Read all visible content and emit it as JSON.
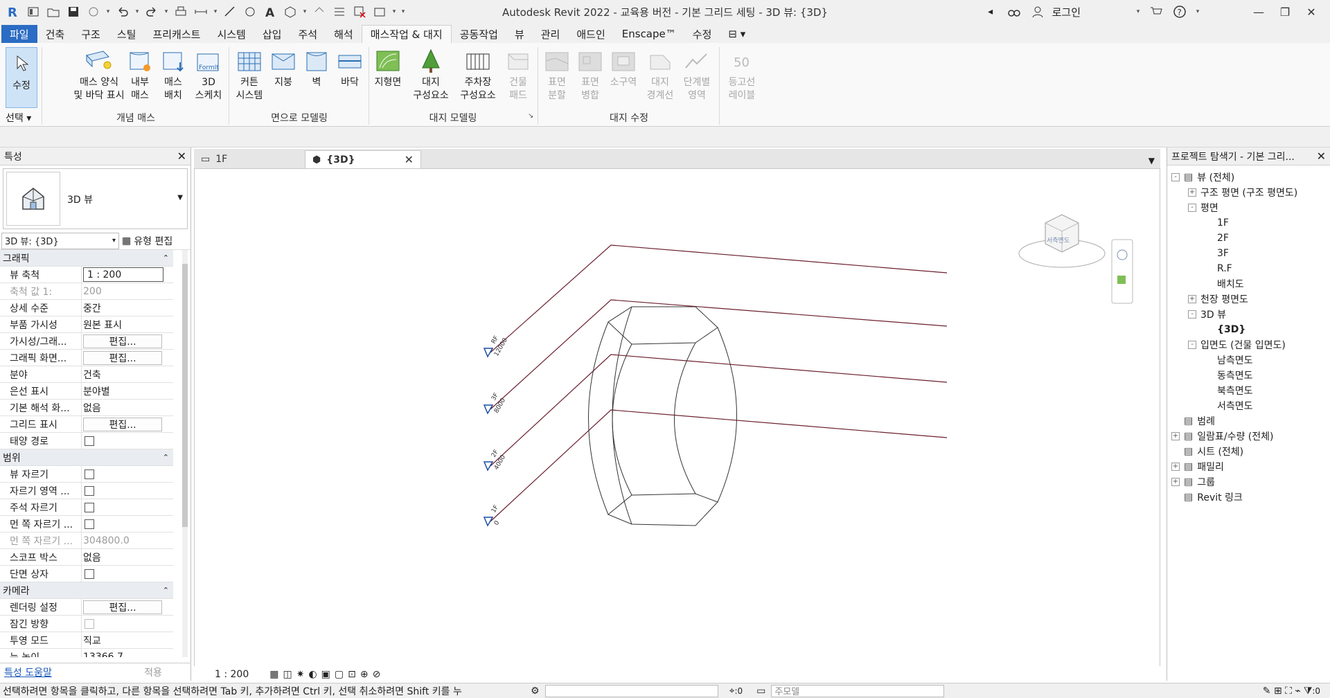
{
  "app": {
    "title": "Autodesk Revit 2022 - 교육용 버전 - 기본 그리드 세팅 - 3D 뷰: {3D}",
    "login_label": "로그인"
  },
  "menu": {
    "tabs": [
      "파일",
      "건축",
      "구조",
      "스틸",
      "프리캐스트",
      "시스템",
      "삽입",
      "주석",
      "해석",
      "매스작업 & 대지",
      "공동작업",
      "뷰",
      "관리",
      "애드인",
      "Enscape™",
      "수정"
    ],
    "active_tab": "매스작업 & 대지"
  },
  "ribbon": {
    "modify_label": "수정",
    "select_label": "선택",
    "buttons": {
      "show_mass_l1": "매스 양식",
      "show_mass_l2": "및 바닥 표시",
      "inplace_mass_l1": "내부",
      "inplace_mass_l2": "매스",
      "place_mass_l1": "매스",
      "place_mass_l2": "배치",
      "sketch3d_l1": "3D",
      "sketch3d_l2": "스케치",
      "curtain_l1": "커튼",
      "curtain_l2": "시스템",
      "roof": "지붕",
      "wall": "벽",
      "floor": "바닥",
      "toposurface": "지형면",
      "site_component_l1": "대지",
      "site_component_l2": "구성요소",
      "parking_l1": "주차장",
      "parking_l2": "구성요소",
      "building_pad_l1": "건물",
      "building_pad_l2": "패드",
      "split_surface_l1": "표면",
      "split_surface_l2": "분할",
      "merge_surface_l1": "표면",
      "merge_surface_l2": "병합",
      "subregion": "소구역",
      "property_line_l1": "대지",
      "property_line_l2": "경계선",
      "graded_region_l1": "단계별",
      "graded_region_l2": "영역",
      "label_contours_l1": "등고선",
      "label_contours_l2": "레이블"
    },
    "panels": {
      "conceptual_mass": "개념 매스",
      "model_by_face": "면으로 모델링",
      "model_site": "대지 모델링",
      "modify_site": "대지 수정"
    }
  },
  "properties": {
    "header": "특성",
    "type_name": "3D 뷰",
    "instance_selector": "3D 뷰: {3D}",
    "edit_type": "유형 편집",
    "rows": [
      {
        "section": "그래픽"
      },
      {
        "k": "뷰 축척",
        "v": "1 : 200",
        "kind": "input"
      },
      {
        "k": "축척 값    1:",
        "v": "200",
        "kind": "dim"
      },
      {
        "k": "상세 수준",
        "v": "중간"
      },
      {
        "k": "부품 가시성",
        "v": "원본 표시"
      },
      {
        "k": "가시성/그래...",
        "v": "편집...",
        "kind": "btn"
      },
      {
        "k": "그래픽 화면...",
        "v": "편집...",
        "kind": "btn"
      },
      {
        "k": "분야",
        "v": "건축"
      },
      {
        "k": "은선 표시",
        "v": "분야별"
      },
      {
        "k": "기본 해석 화...",
        "v": "없음"
      },
      {
        "k": "그리드 표시",
        "v": "편집...",
        "kind": "btn"
      },
      {
        "k": "태양 경로",
        "v": "",
        "kind": "chk"
      },
      {
        "section": "범위"
      },
      {
        "k": "뷰 자르기",
        "v": "",
        "kind": "chk"
      },
      {
        "k": "자르기 영역 ...",
        "v": "",
        "kind": "chk"
      },
      {
        "k": "주석 자르기",
        "v": "",
        "kind": "chk"
      },
      {
        "k": "먼 쪽 자르기 ...",
        "v": "",
        "kind": "chk"
      },
      {
        "k": "먼 쪽 자르기 ...",
        "v": "304800.0",
        "kind": "dim"
      },
      {
        "k": "스코프 박스",
        "v": "없음"
      },
      {
        "k": "단면 상자",
        "v": "",
        "kind": "chk"
      },
      {
        "section": "카메라"
      },
      {
        "k": "렌더링 설정",
        "v": "편집...",
        "kind": "btn"
      },
      {
        "k": "잠긴 방향",
        "v": "",
        "kind": "chkdim"
      },
      {
        "k": "투영 모드",
        "v": "직교"
      },
      {
        "k": "눈 높이",
        "v": "13366.7"
      }
    ],
    "help_link": "특성 도움말",
    "apply": "적용"
  },
  "view_tabs": [
    {
      "label": "1F"
    },
    {
      "label": "{3D}"
    }
  ],
  "viewport": {
    "scale": "1 : 200",
    "viewcube_label": "서측면도",
    "levels": [
      {
        "name": "RF",
        "elev": "12000"
      },
      {
        "name": "3F",
        "elev": "8000"
      },
      {
        "name": "2F",
        "elev": "4000"
      },
      {
        "name": "1F",
        "elev": "0"
      }
    ]
  },
  "browser": {
    "header": "프로젝트 탐색기 - 기본 그리...",
    "items": [
      {
        "label": "뷰 (전체)",
        "level": 0,
        "exp": "-",
        "icon": true
      },
      {
        "label": "구조 평면 (구조 평면도)",
        "level": 1,
        "exp": "+"
      },
      {
        "label": "평면",
        "level": 1,
        "exp": "-"
      },
      {
        "label": "1F",
        "level": 2
      },
      {
        "label": "2F",
        "level": 2
      },
      {
        "label": "3F",
        "level": 2
      },
      {
        "label": "R.F",
        "level": 2
      },
      {
        "label": "배치도",
        "level": 2
      },
      {
        "label": "천장 평면도",
        "level": 1,
        "exp": "+"
      },
      {
        "label": "3D 뷰",
        "level": 1,
        "exp": "-"
      },
      {
        "label": "{3D}",
        "level": 2,
        "bold": true
      },
      {
        "label": "입면도 (건물 입면도)",
        "level": 1,
        "exp": "-"
      },
      {
        "label": "남측면도",
        "level": 2
      },
      {
        "label": "동측면도",
        "level": 2
      },
      {
        "label": "북측면도",
        "level": 2
      },
      {
        "label": "서측면도",
        "level": 2
      },
      {
        "label": "범례",
        "level": 0,
        "icon": true
      },
      {
        "label": "일람표/수량 (전체)",
        "level": 0,
        "exp": "+",
        "icon": true
      },
      {
        "label": "시트 (전체)",
        "level": 0,
        "icon": true
      },
      {
        "label": "패밀리",
        "level": 0,
        "exp": "+",
        "icon": true
      },
      {
        "label": "그룹",
        "level": 0,
        "exp": "+",
        "icon": true
      },
      {
        "label": "Revit 링크",
        "level": 0,
        "icon": true
      }
    ]
  },
  "status": {
    "message": "선택하려면 항목을 클릭하고, 다른 항목을 선택하려면 Tab 키, 추가하려면 Ctrl 키, 선택 취소하려면 Shift 키를 누",
    "count": ":0",
    "model_selector": "주모델",
    "right_count": ":0"
  },
  "colors": {
    "accent": "#2b6cc4",
    "level_line": "#6b1f2e",
    "mass_line": "#333333"
  }
}
